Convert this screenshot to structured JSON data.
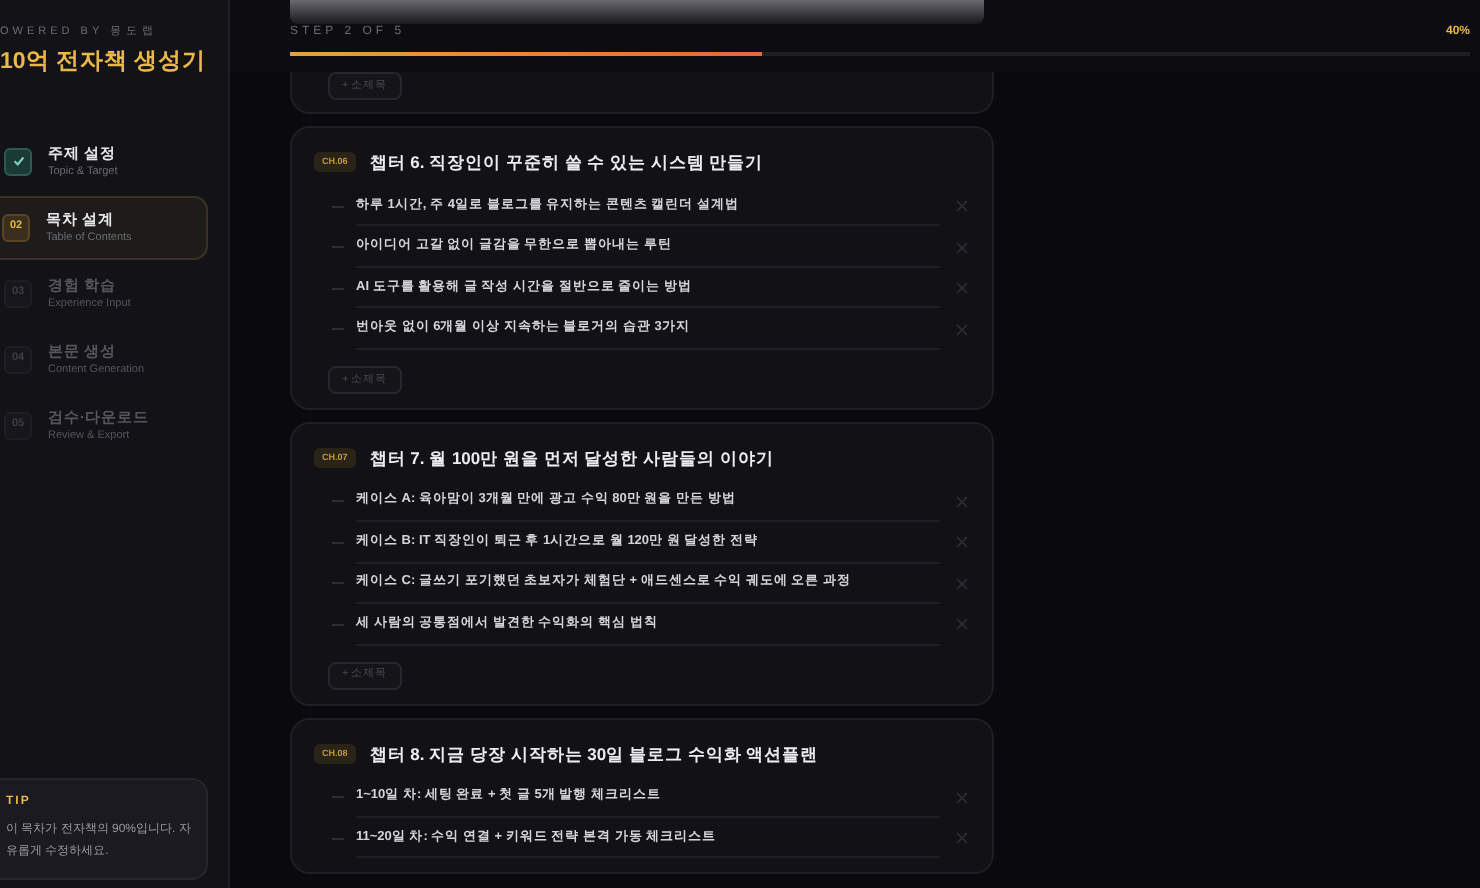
{
  "sidebar": {
    "brand": "OWERED BY 몽도랩",
    "title": "10억 전자책 생성기",
    "steps": [
      {
        "title": "주제 설정",
        "subtitle": "Topic & Target",
        "completed": true,
        "selected": false
      },
      {
        "number": "02",
        "title": "목차 설계",
        "subtitle": "Table of Contents",
        "completed": false,
        "selected": true
      },
      {
        "number": "03",
        "title": "경험 학습",
        "subtitle": "Experience Input",
        "completed": false,
        "selected": false
      },
      {
        "number": "04",
        "title": "본문 생성",
        "subtitle": "Content Generation",
        "completed": false,
        "selected": false
      },
      {
        "number": "05",
        "title": "검수·다운로드",
        "subtitle": "Review & Export",
        "completed": false,
        "selected": false
      }
    ],
    "tip": {
      "label": "TIP",
      "text": "이 목차가 전자책의 90%입니다. 자유롭게 수정하세요."
    }
  },
  "progress": {
    "step_label": "STEP 2 OF 5",
    "percent": "40%",
    "level": 0.4
  },
  "previous_card": {
    "add_button": "+ 소제목"
  },
  "chapters": [
    {
      "badge": "CH.06",
      "title": "챕터 6. 직장인이 꾸준히 쓸 수 있는 시스템 만들기",
      "sections": [
        "하루 1시간, 주 4일로 블로그를 유지하는 콘텐츠 캘린더 설계법",
        "아이디어 고갈 없이 글감을 무한으로 뽑아내는 루틴",
        "AI 도구를 활용해 글 작성 시간을 절반으로 줄이는 방법",
        "번아웃 없이 6개월 이상 지속하는 블로거의 습관 3가지"
      ],
      "add_button": "+ 소제목"
    },
    {
      "badge": "CH.07",
      "title": "챕터 7. 월 100만 원을 먼저 달성한 사람들의 이야기",
      "sections": [
        "케이스 A: 육아맘이 3개월 만에 광고 수익 80만 원을 만든 방법",
        "케이스 B: IT 직장인이 퇴근 후 1시간으로 월 120만 원 달성한 전략",
        "케이스 C: 글쓰기 포기했던 초보자가 체험단 + 애드센스로 수익 궤도에 오른 과정",
        "세 사람의 공통점에서 발견한 수익화의 핵심 법칙"
      ],
      "add_button": "+ 소제목"
    },
    {
      "badge": "CH.08",
      "title": "챕터 8. 지금 당장 시작하는 30일 블로그 수익화 액션플랜",
      "sections": [
        "1~10일 차: 세팅 완료 + 첫 글 5개 발행 체크리스트",
        "11~20일 차: 수익 연결 + 키워드 전략 본격 가동 체크리스트"
      ]
    }
  ]
}
